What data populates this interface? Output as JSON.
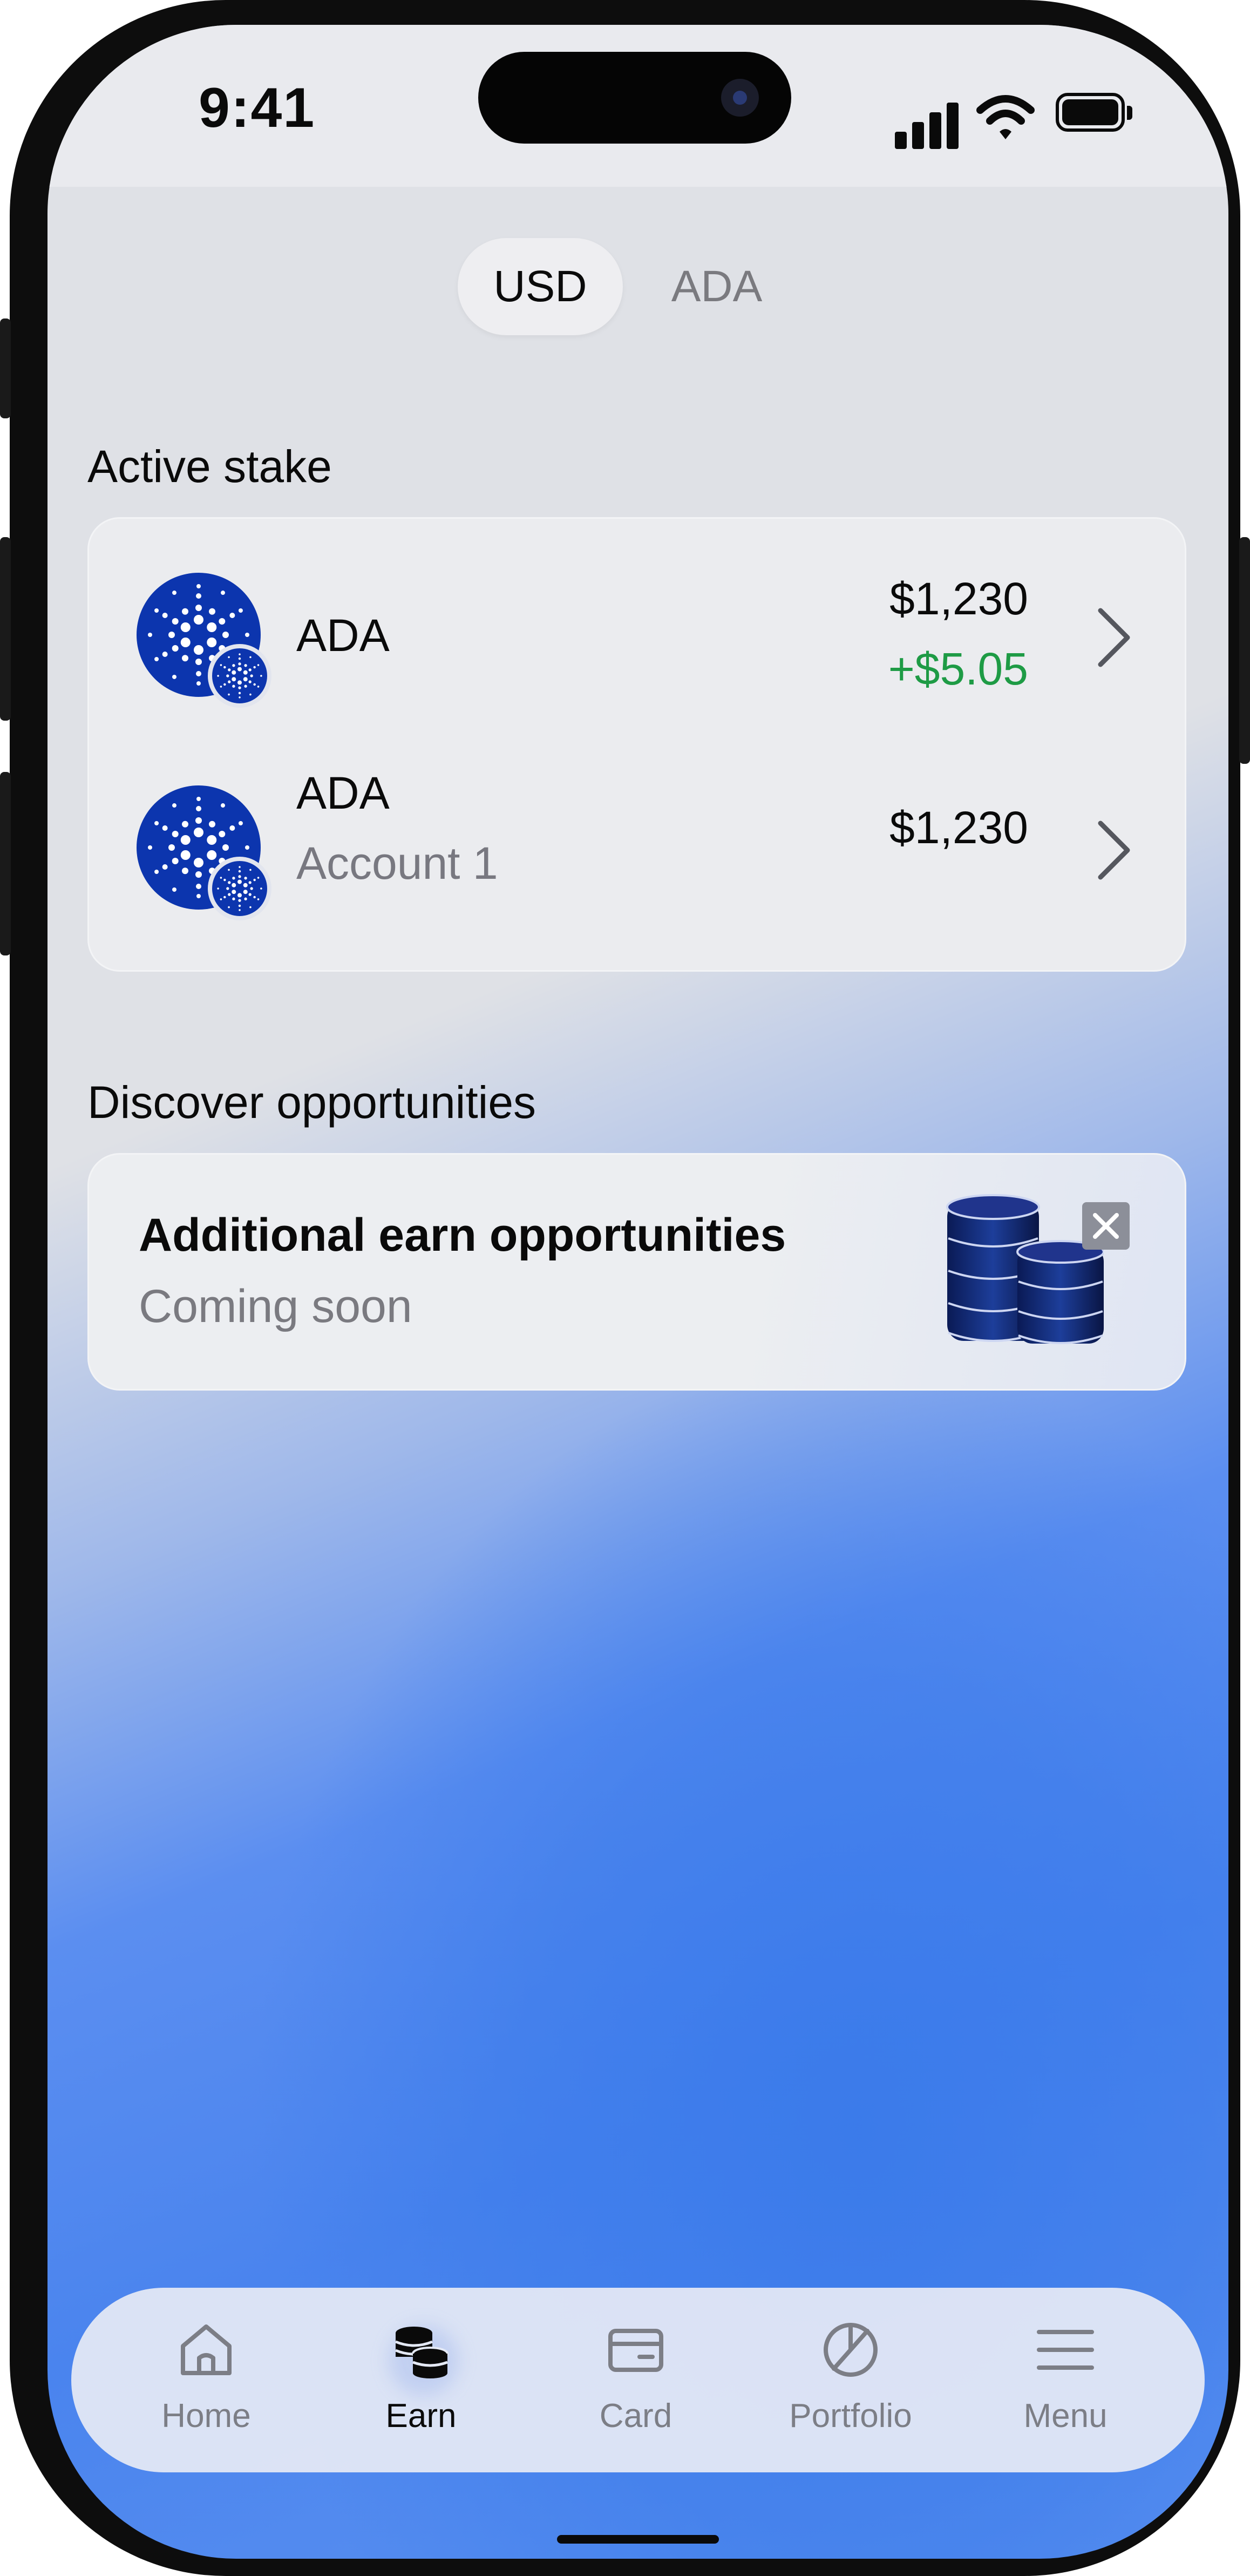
{
  "status_bar": {
    "time": "9:41"
  },
  "currency_toggle": {
    "options": [
      "USD",
      "ADA"
    ],
    "selected": "USD"
  },
  "active_stake": {
    "title": "Active stake",
    "items": [
      {
        "asset": "ADA",
        "subtitle": "",
        "amount": "$1,230",
        "change": "+$5.05"
      },
      {
        "asset": "ADA",
        "subtitle": "Account 1",
        "amount": "$1,230",
        "change": ""
      }
    ]
  },
  "discover": {
    "title": "Discover opportunities",
    "card": {
      "title": "Additional earn opportunities",
      "subtitle": "Coming soon"
    }
  },
  "colors": {
    "accent": "#0c35ae",
    "positive": "#1e9b45",
    "background_gradient": "#4a84ee"
  },
  "nav": {
    "items": [
      {
        "label": "Home",
        "icon": "home-icon"
      },
      {
        "label": "Earn",
        "icon": "coins-icon"
      },
      {
        "label": "Card",
        "icon": "card-icon"
      },
      {
        "label": "Portfolio",
        "icon": "pie-chart-icon"
      },
      {
        "label": "Menu",
        "icon": "menu-icon"
      }
    ],
    "active": "Earn"
  }
}
